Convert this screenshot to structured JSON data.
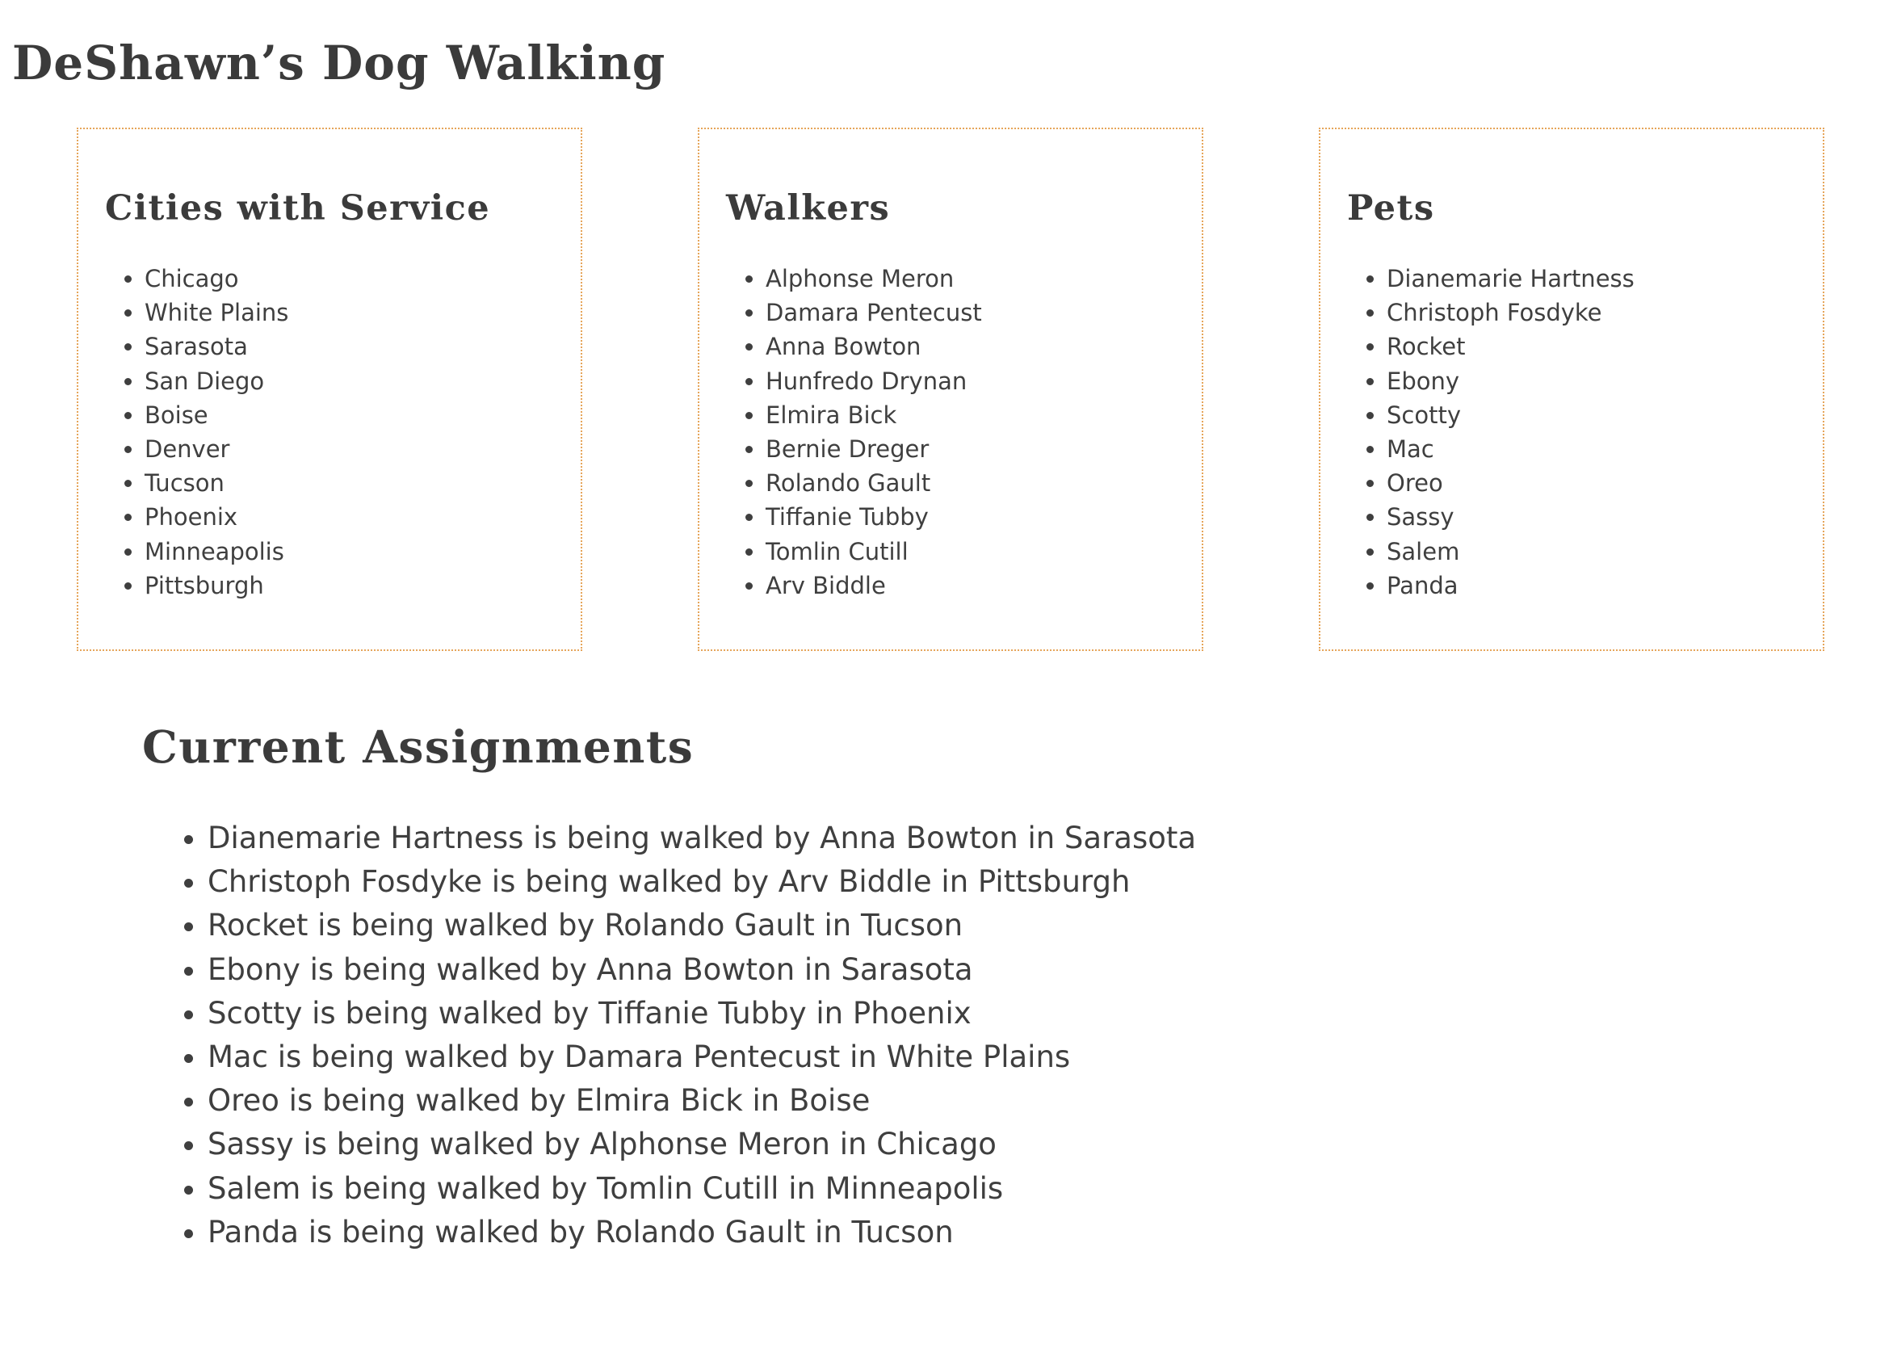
{
  "site": {
    "title": "DeShawn’s Dog Walking"
  },
  "panels": {
    "cities": {
      "heading": "Cities with Service",
      "items": [
        "Chicago",
        "White Plains",
        "Sarasota",
        "San Diego",
        "Boise",
        "Denver",
        "Tucson",
        "Phoenix",
        "Minneapolis",
        "Pittsburgh"
      ]
    },
    "walkers": {
      "heading": "Walkers",
      "items": [
        "Alphonse Meron",
        "Damara Pentecust",
        "Anna Bowton",
        "Hunfredo Drynan",
        "Elmira Bick",
        "Bernie Dreger",
        "Rolando Gault",
        "Tiffanie Tubby",
        "Tomlin Cutill",
        "Arv Biddle"
      ]
    },
    "pets": {
      "heading": "Pets",
      "items": [
        "Dianemarie Hartness",
        "Christoph Fosdyke",
        "Rocket",
        "Ebony",
        "Scotty",
        "Mac",
        "Oreo",
        "Sassy",
        "Salem",
        "Panda"
      ]
    }
  },
  "assignments": {
    "heading": "Current Assignments",
    "items": [
      "Dianemarie Hartness is being walked by Anna Bowton in Sarasota",
      "Christoph Fosdyke is being walked by Arv Biddle in Pittsburgh",
      "Rocket is being walked by Rolando Gault in Tucson",
      "Ebony is being walked by Anna Bowton in Sarasota",
      "Scotty is being walked by Tiffanie Tubby in Phoenix",
      "Mac is being walked by Damara Pentecust in White Plains",
      "Oreo is being walked by Elmira Bick in Boise",
      "Sassy is being walked by Alphonse Meron in Chicago",
      "Salem is being walked by Tomlin Cutill in Minneapolis",
      "Panda is being walked by Rolando Gault in Tucson"
    ]
  },
  "colors": {
    "text": "#3b3b3b",
    "panel_border": "#e6a55a",
    "background": "#ffffff"
  }
}
